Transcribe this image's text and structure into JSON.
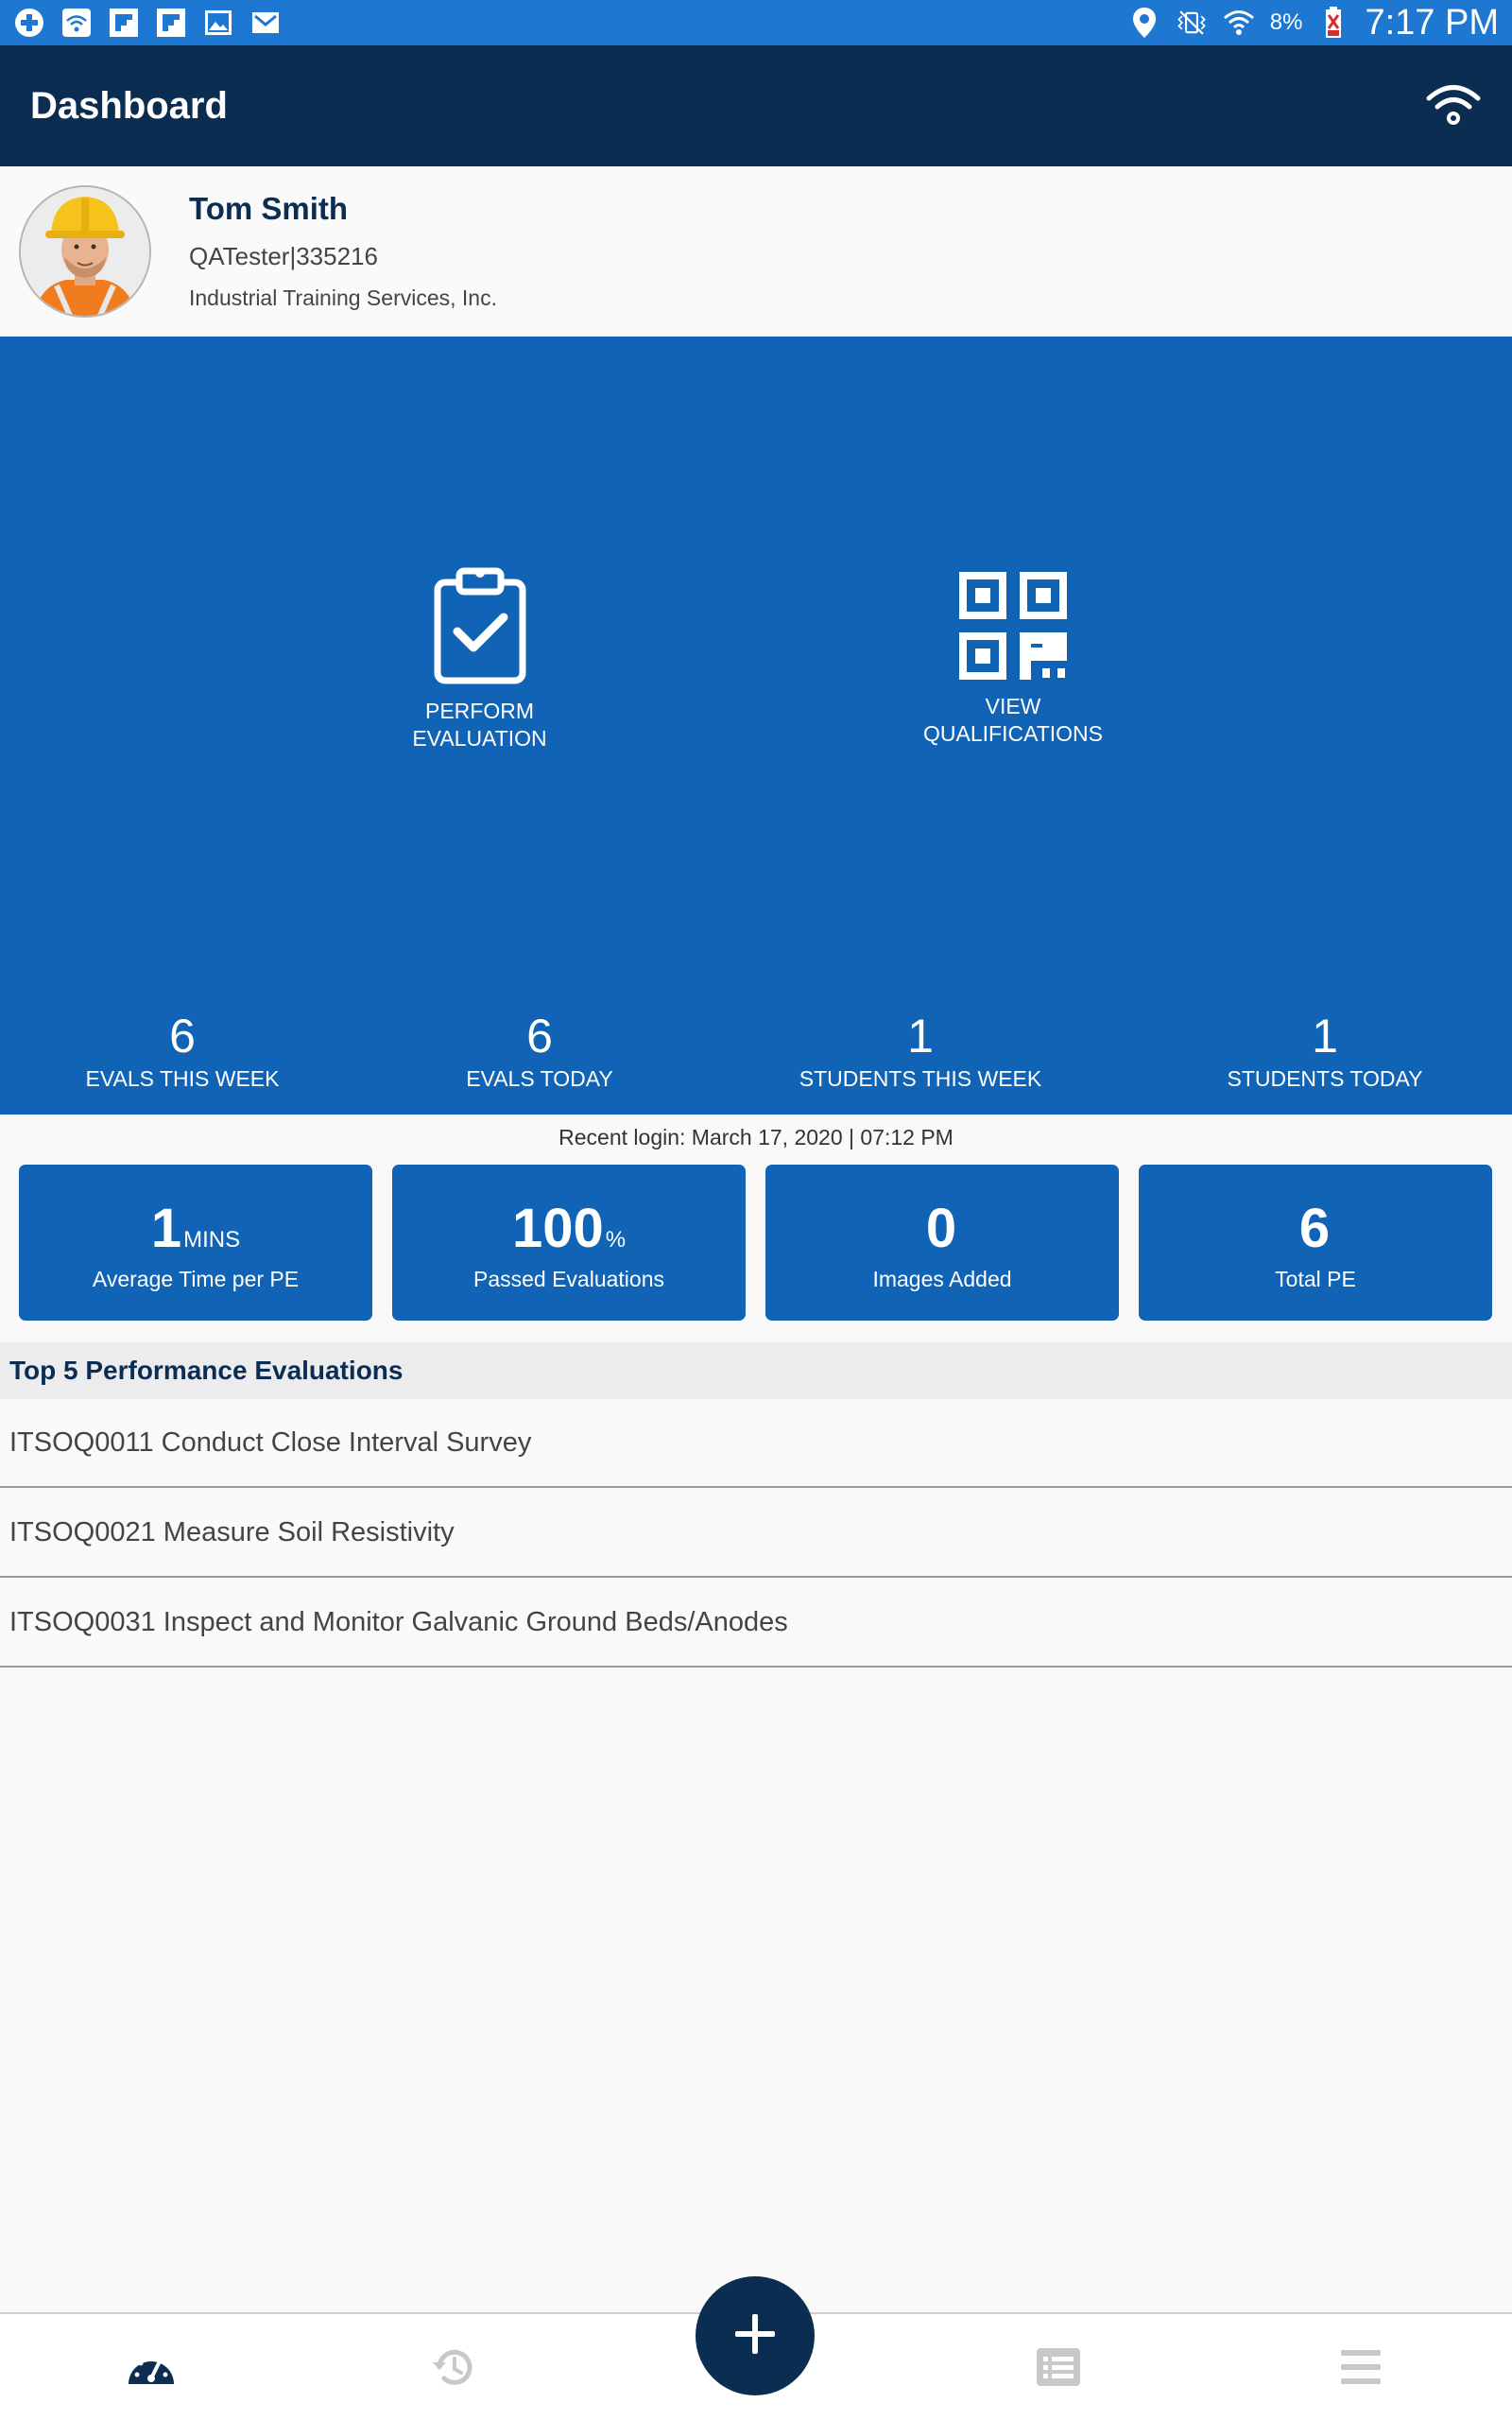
{
  "status_bar": {
    "left_icons": [
      "medical-cross-icon",
      "wifi-box-icon",
      "flipboard-icon",
      "flipboard-icon",
      "image-icon",
      "gmail-icon"
    ],
    "right_icons": [
      "location-pin-icon",
      "vibrate-mute-icon",
      "wifi-icon",
      "battery-low-icon"
    ],
    "battery": "8%",
    "time": "7:17 PM"
  },
  "app_bar": {
    "title": "Dashboard",
    "icon": "wifi-icon"
  },
  "profile": {
    "name": "Tom Smith",
    "user_id": "QATester|335216",
    "company": "Industrial Training Services, Inc."
  },
  "actions": {
    "perform": {
      "line1": "PERFORM",
      "line2": "EVALUATION",
      "icon": "clipboard-check-icon"
    },
    "view": {
      "line1": "VIEW",
      "line2": "QUALIFICATIONS",
      "icon": "qr-code-icon"
    }
  },
  "stats": [
    {
      "value": "6",
      "label": "EVALS THIS WEEK"
    },
    {
      "value": "6",
      "label": "EVALS TODAY"
    },
    {
      "value": "1",
      "label": "STUDENTS THIS WEEK"
    },
    {
      "value": "1",
      "label": "STUDENTS TODAY"
    }
  ],
  "recent_login": "Recent login: March 17, 2020 | 07:12 PM",
  "cards": [
    {
      "value": "1",
      "unit": "MINS",
      "label": "Average Time per PE"
    },
    {
      "value": "100",
      "unit": "%",
      "label": "Passed Evaluations"
    },
    {
      "value": "0",
      "unit": "",
      "label": "Images Added"
    },
    {
      "value": "6",
      "unit": "",
      "label": "Total PE"
    }
  ],
  "top_pe": {
    "title": "Top 5 Performance Evaluations",
    "items": [
      "ITSOQ0011 Conduct Close Interval Survey",
      "ITSOQ0021 Measure Soil Resistivity",
      "ITSOQ0031 Inspect and Monitor Galvanic Ground Beds/Anodes"
    ]
  },
  "bottom_nav": {
    "items": [
      "dashboard-gauge-icon",
      "history-icon",
      "list-icon",
      "menu-icon"
    ],
    "fab_icon": "plus-icon",
    "active_color": "#0c2d52",
    "inactive_color": "#c8c8c8"
  },
  "colors": {
    "status_bar": "#1e78d2",
    "app_bar": "#0c2d52",
    "primary": "#1063b5",
    "section_header": "#ecebee"
  }
}
